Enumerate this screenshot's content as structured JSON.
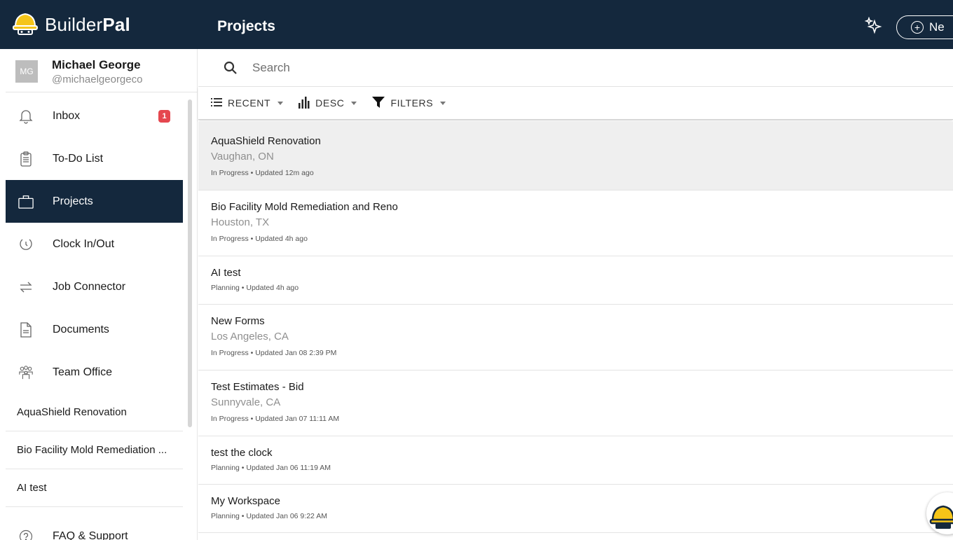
{
  "brand": {
    "name_regular": "Builder",
    "name_bold": "Pal"
  },
  "header": {
    "title": "Projects",
    "new_label": "Ne"
  },
  "user": {
    "initials": "MG",
    "name": "Michael George",
    "handle": "@michaelgeorgeco"
  },
  "nav": {
    "inbox": {
      "label": "Inbox",
      "badge": "1"
    },
    "todo": {
      "label": "To-Do List"
    },
    "projects": {
      "label": "Projects"
    },
    "clock": {
      "label": "Clock In/Out"
    },
    "job": {
      "label": "Job Connector"
    },
    "documents": {
      "label": "Documents"
    },
    "team": {
      "label": "Team Office"
    },
    "faq": {
      "label": "FAQ & Support"
    }
  },
  "recent_projects": [
    "AquaShield Renovation",
    "Bio Facility Mold Remediation ...",
    "AI test"
  ],
  "search": {
    "placeholder": "Search"
  },
  "toolbar": {
    "sort": "RECENT",
    "order": "DESC",
    "filters": "FILTERS"
  },
  "projects": [
    {
      "title": "AquaShield Renovation",
      "location": "Vaughan, ON",
      "meta": "In Progress • Updated 12m ago"
    },
    {
      "title": "Bio Facility Mold Remediation and Reno",
      "location": "Houston, TX",
      "meta": "In Progress • Updated 4h ago"
    },
    {
      "title": "AI test",
      "location": "",
      "meta": "Planning • Updated 4h ago"
    },
    {
      "title": "New Forms",
      "location": "Los Angeles, CA",
      "meta": "In Progress • Updated Jan 08 2:39 PM"
    },
    {
      "title": "Test Estimates - Bid",
      "location": "Sunnyvale, CA",
      "meta": "In Progress • Updated Jan 07 11:11 AM"
    },
    {
      "title": "test the clock",
      "location": "",
      "meta": "Planning • Updated Jan 06 11:19 AM"
    },
    {
      "title": "My Workspace",
      "location": "",
      "meta": "Planning • Updated Jan 06 9:22 AM"
    }
  ],
  "colors": {
    "navy": "#14283d",
    "badge_red": "#e5474f",
    "helmet_yellow": "#f5c518"
  },
  "icons": [
    "helmet-icon",
    "sparkle-icon",
    "plus-circle-icon",
    "bell-icon",
    "clipboard-icon",
    "briefcase-icon",
    "clock-icon",
    "swap-arrows-icon",
    "document-icon",
    "team-icon",
    "help-icon",
    "search-icon",
    "list-icon",
    "bar-chart-icon",
    "filter-icon"
  ]
}
